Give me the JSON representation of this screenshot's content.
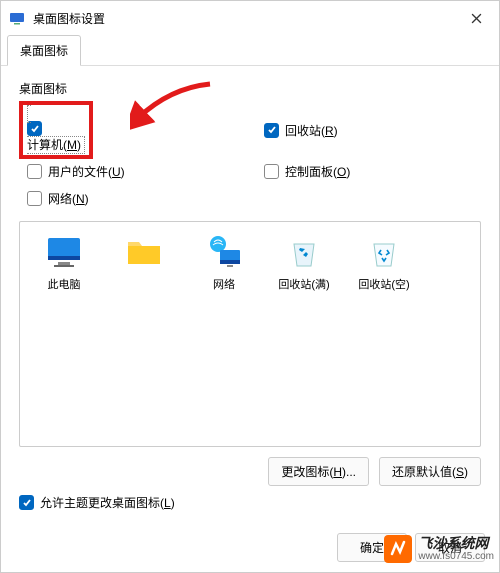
{
  "window": {
    "title": "桌面图标设置"
  },
  "tab": {
    "label": "桌面图标"
  },
  "group": {
    "label": "桌面图标"
  },
  "checks": {
    "computer": {
      "label_pre": "计算机(",
      "accel": "M",
      "label_post": ")",
      "checked": true
    },
    "recycle": {
      "label_pre": "回收站(",
      "accel": "R",
      "label_post": ")",
      "checked": true
    },
    "userfiles": {
      "label_pre": "用户的文件(",
      "accel": "U",
      "label_post": ")",
      "checked": false
    },
    "control": {
      "label_pre": "控制面板(",
      "accel": "O",
      "label_post": ")",
      "checked": false
    },
    "network": {
      "label_pre": "网络(",
      "accel": "N",
      "label_post": ")",
      "checked": false
    }
  },
  "icons": {
    "thispc": {
      "label": "此电脑"
    },
    "user": {
      "label": "　"
    },
    "network": {
      "label": "网络"
    },
    "bin_full": {
      "label": "回收站(满)"
    },
    "bin_empty": {
      "label": "回收站(空)"
    }
  },
  "buttons": {
    "change": {
      "label_pre": "更改图标(",
      "accel": "H",
      "label_post": ")..."
    },
    "restore": {
      "label_pre": "还原默认值(",
      "accel": "S",
      "label_post": ")"
    },
    "ok": "确定",
    "cancel": "取消"
  },
  "allow": {
    "label_pre": "允许主题更改桌面图标(",
    "accel": "L",
    "label_post": ")",
    "checked": true
  },
  "watermark": {
    "line1": "飞沙系统网",
    "line2": "www.fs0745.com"
  },
  "colors": {
    "accent": "#0067c0",
    "highlight": "#e21b1b"
  }
}
